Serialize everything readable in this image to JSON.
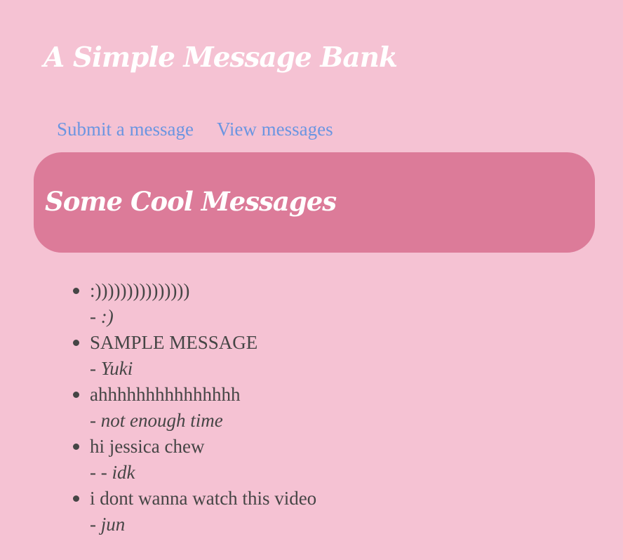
{
  "header": {
    "title": "A Simple Message Bank"
  },
  "nav": {
    "submit_label": "Submit a message",
    "view_label": "View messages"
  },
  "banner": {
    "title": "Some Cool Messages"
  },
  "messages": [
    {
      "text": ":)))))))))))))))",
      "author_prefix": "- ",
      "author": ":)"
    },
    {
      "text": "SAMPLE MESSAGE",
      "author_prefix": "- ",
      "author": "Yuki"
    },
    {
      "text": "ahhhhhhhhhhhhhhh",
      "author_prefix": "- ",
      "author": "not enough time"
    },
    {
      "text": "hi jessica chew",
      "author_prefix": "- - ",
      "author": "idk"
    },
    {
      "text": "i dont wanna watch this video",
      "author_prefix": "- ",
      "author": "jun"
    }
  ],
  "colors": {
    "background": "#f5c2d3",
    "banner": "#dc7b99",
    "link": "#6b95e1",
    "text": "#454545",
    "heading": "#ffffff"
  }
}
